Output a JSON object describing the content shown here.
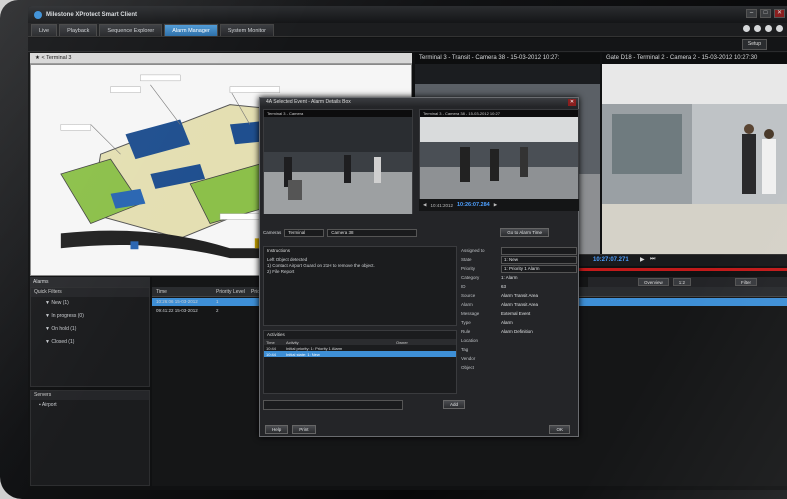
{
  "app": {
    "title": "Milestone XProtect Smart Client"
  },
  "tabs": [
    {
      "label": "Live"
    },
    {
      "label": "Playback"
    },
    {
      "label": "Sequence Explorer"
    },
    {
      "label": "Alarm Manager"
    },
    {
      "label": "System Monitor"
    }
  ],
  "toolbar": {
    "setup_label": "Setup"
  },
  "map": {
    "breadcrumb": "Terminal 3"
  },
  "cameras": {
    "pane1_title": "Terminal 3 - Transit - Camera 38 - 15-03-2012 10:27:",
    "pane2_title": "Gate D18 - Terminal 2 - Camera 2 - 15-03-2012 10:27:30",
    "timecode": "10:27:07.271"
  },
  "alarms": {
    "panel_label": "Alarms",
    "quick_filters_label": "Quick Filters",
    "filters": [
      {
        "label": "New (1)"
      },
      {
        "label": "In progress (0)"
      },
      {
        "label": "On hold (1)"
      },
      {
        "label": "Closed (1)"
      }
    ],
    "servers_label": "Servers",
    "servers": [
      {
        "label": "Airport"
      }
    ],
    "columns": [
      "Time",
      "Priority Level",
      "Priority N"
    ],
    "rows": [
      {
        "time": "10:26:06 15-03-2012",
        "level": "1"
      },
      {
        "time": "09:41:22 15-03-2012",
        "level": "2"
      }
    ],
    "right_buttons": [
      "Overview",
      "1:2"
    ],
    "filter_label": "Filter"
  },
  "dialog": {
    "title": "4A Selected Event - Alarm Details Box",
    "cam1_title": "Terminal 3 - Camera",
    "cam2_title": "Terminal 3 - Camera 38 - 15-03-2012 10:27",
    "tc_small": "10:41:2012",
    "tc_main": "10:26:07.284",
    "cameras_label": "Cameras",
    "camera_select1": "Terminal",
    "camera_select2": "Camera 38",
    "goto_button": "Go to Alarm Time",
    "instructions_label": "Instructions",
    "instructions_text": "Left Object detected",
    "instructions_lines": [
      "1) Contact Airport Guard on 21H to remove the object.",
      "2) File Report"
    ],
    "props": [
      {
        "k": "Assigned to",
        "v": "",
        "box": true
      },
      {
        "k": "State",
        "v": "1: New",
        "box": true
      },
      {
        "k": "Priority",
        "v": "1: Priority 1 Alarm",
        "box": true
      },
      {
        "k": "Category",
        "v": "1: Alarm",
        "box": false
      },
      {
        "k": "ID",
        "v": "63",
        "box": false
      },
      {
        "k": "Source",
        "v": "Alarm Transit Area",
        "box": false
      },
      {
        "k": "Alarm",
        "v": "Alarm Transit Area",
        "box": false
      },
      {
        "k": "Message",
        "v": "External Event",
        "box": false
      },
      {
        "k": "Type",
        "v": "Alarm",
        "box": false
      },
      {
        "k": "Rule",
        "v": "Alarm Definition",
        "box": false
      },
      {
        "k": "Location",
        "v": "",
        "box": false
      },
      {
        "k": "Tag",
        "v": "",
        "box": false
      },
      {
        "k": "Vendor",
        "v": "",
        "box": false
      },
      {
        "k": "Object",
        "v": "",
        "box": false
      }
    ],
    "activities_label": "Activities",
    "activity_columns": [
      "Time",
      "Activity",
      "Owner"
    ],
    "activities": [
      {
        "time": "10:44",
        "activity": "Initial priority: 1: Priority 1 Alarm",
        "owner": ""
      },
      {
        "time": "10:44",
        "activity": "Initial state: 1: New",
        "owner": ""
      }
    ],
    "add_button": "Add",
    "help_button": "Help",
    "print_button": "Print",
    "ok_button": "OK"
  }
}
